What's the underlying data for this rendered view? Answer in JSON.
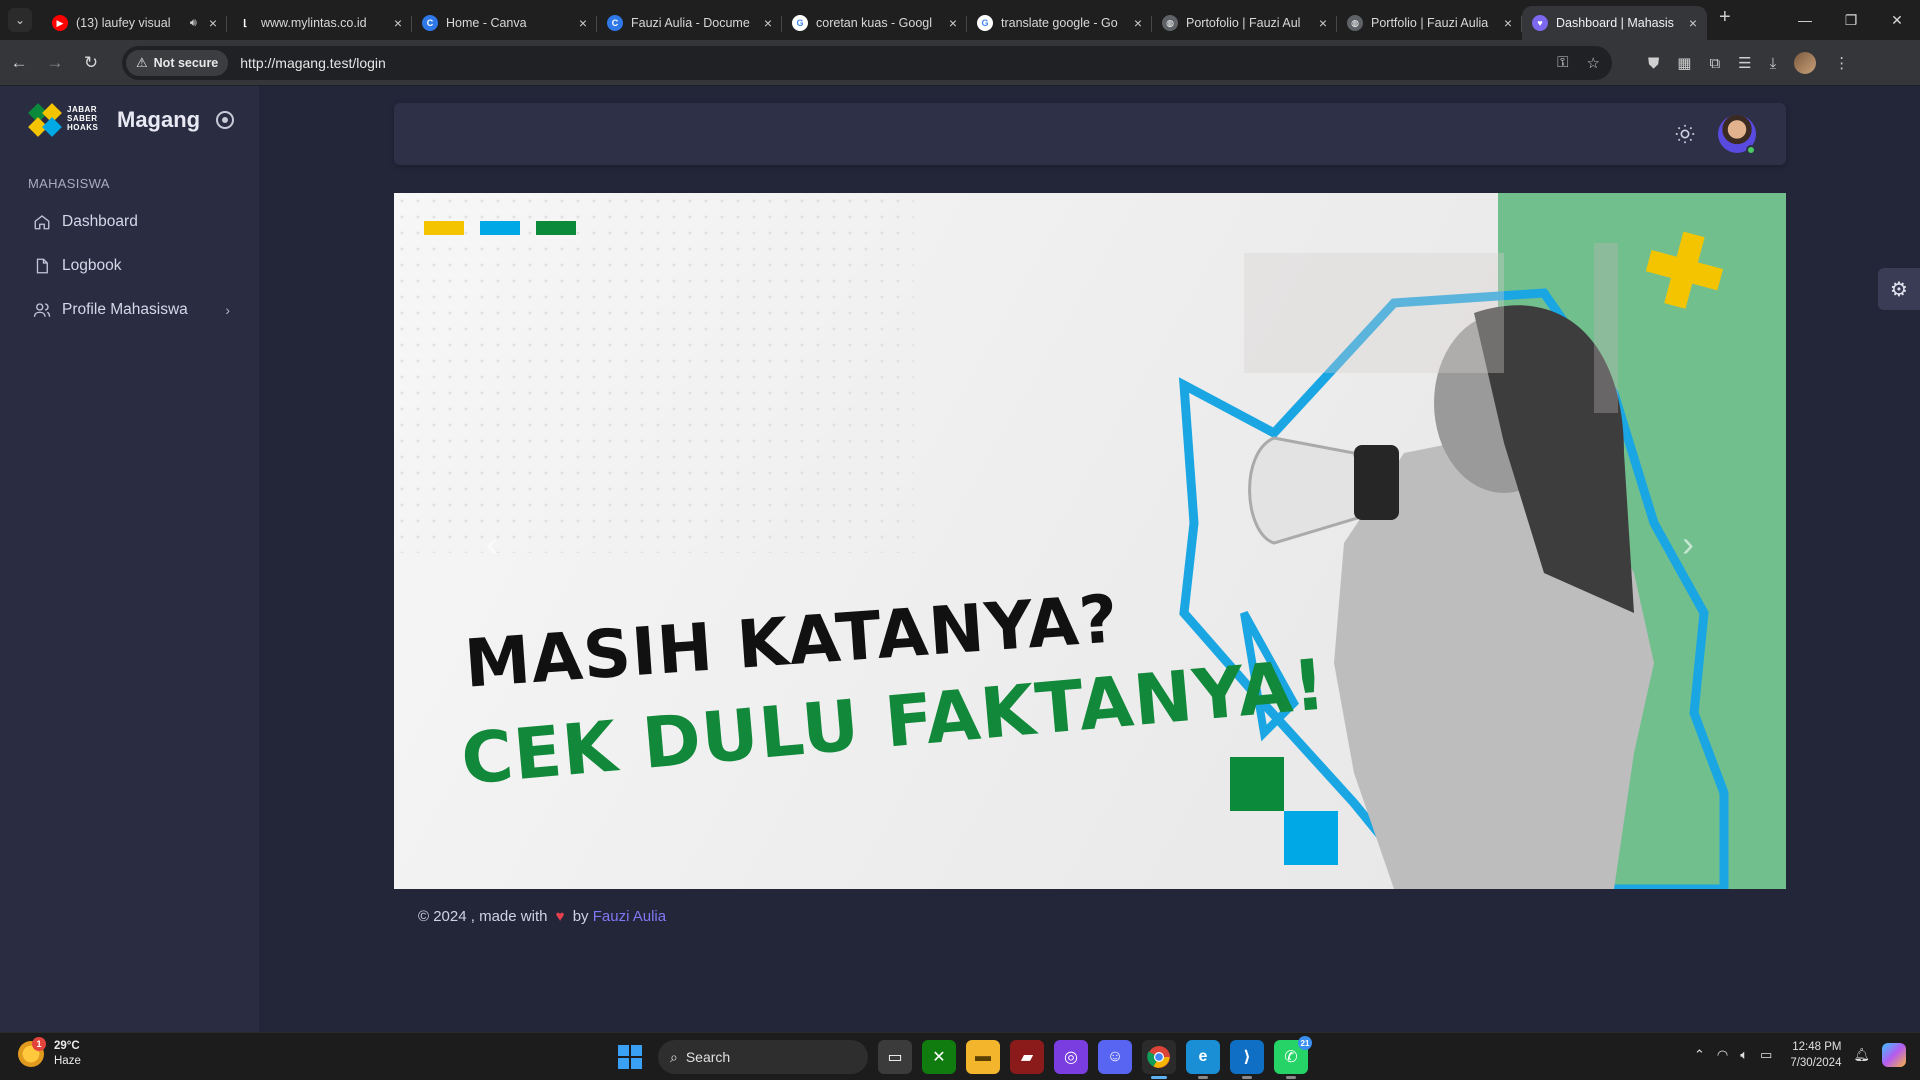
{
  "browser": {
    "tabs": [
      {
        "title": "(13) laufey visual",
        "favicon": "youtube-icon",
        "color": "#ff0000",
        "glyph": "▶",
        "speaker": true
      },
      {
        "title": "www.mylintas.co.id",
        "favicon": "hook-icon",
        "color": "transparent",
        "glyph": "⌊"
      },
      {
        "title": "Home - Canva",
        "favicon": "canva-icon",
        "color": "#2f78e8",
        "glyph": "C"
      },
      {
        "title": "Fauzi Aulia - Docume",
        "favicon": "canva-icon",
        "color": "#2f78e8",
        "glyph": "C"
      },
      {
        "title": "coretan kuas - Googl",
        "favicon": "google-icon",
        "color": "#ffffff",
        "glyph": "G"
      },
      {
        "title": "translate google - Go",
        "favicon": "google-icon",
        "color": "#ffffff",
        "glyph": "G"
      },
      {
        "title": "Portofolio | Fauzi Aul",
        "favicon": "globe-icon",
        "color": "#5f6368",
        "glyph": "◍"
      },
      {
        "title": "Portfolio | Fauzi Aulia",
        "favicon": "globe-icon",
        "color": "#5f6368",
        "glyph": "◍"
      },
      {
        "title": "Dashboard | Mahasis",
        "favicon": "heart-logo-icon",
        "color": "#7b68ee",
        "glyph": "♥",
        "active": true
      }
    ],
    "security_label": "Not secure",
    "url": "http://magang.test/login"
  },
  "sidebar": {
    "brand_name": "Magang",
    "logo_text": [
      "JABAR",
      "SABER",
      "HOAKS"
    ],
    "section_label": "MAHASISWA",
    "items": [
      {
        "label": "Dashboard",
        "icon": "home-icon"
      },
      {
        "label": "Logbook",
        "icon": "file-icon"
      },
      {
        "label": "Profile Mahasiswa",
        "icon": "users-icon",
        "has_submenu": true
      }
    ]
  },
  "banner": {
    "headline_1": "MASIH KATANYA?",
    "headline_2": "CEK DULU FAKTANYA!",
    "accent_colors": [
      "#f5c400",
      "#00a8e6",
      "#0a8a3a"
    ]
  },
  "footer": {
    "prefix": "© 2024 , made with",
    "by": "by",
    "author": "Fauzi Aulia"
  },
  "taskbar": {
    "weather_temp": "29°C",
    "weather_desc": "Haze",
    "weather_badge": "1",
    "search_label": "Search",
    "time": "12:48 PM",
    "date": "7/30/2024",
    "whatsapp_count": "21"
  }
}
